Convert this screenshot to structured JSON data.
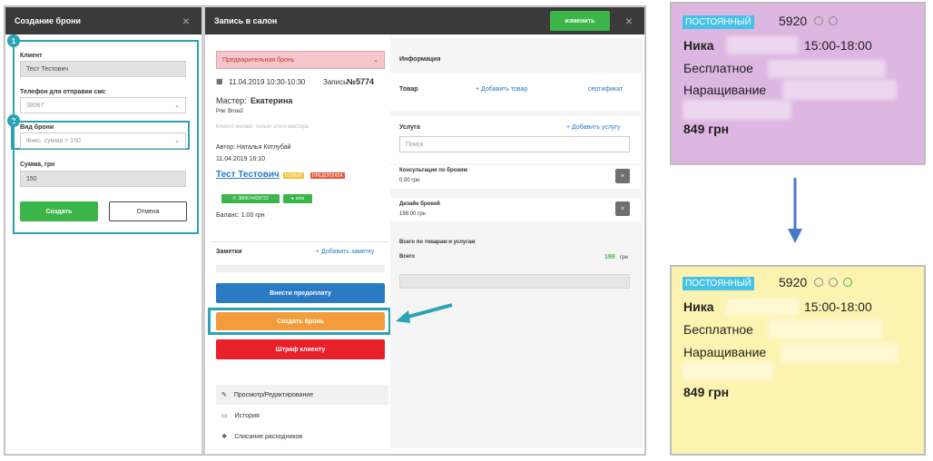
{
  "left_panel": {
    "title": "Создание брони",
    "close_icon": "×",
    "client_label": "Клиент",
    "client_value": "Тест Тестович",
    "phone_label": "Телефон для отправки смс",
    "phone_value": "38067",
    "type_label": "Вид брони",
    "type_value": "Фикс. сумма = 150",
    "sum_label": "Сумма, грн",
    "sum_value": "150",
    "create_label": "Создать",
    "cancel_label": "Отмена",
    "badge1": "1",
    "badge2": "2"
  },
  "right_panel": {
    "title": "Запись в салон",
    "edit_label": "изменить",
    "close_icon": "×",
    "status_value": "Предварительная бронь",
    "date_time": "11.04.2019 10:30-10:30",
    "record_prefix": "Запись ",
    "record_num": "№5774",
    "master_prefix": "Мастер: ",
    "master_name": "Екатерина",
    "room": "Р/м: Brow2",
    "client_wants": "Клиент желает только этого мастера",
    "author": "Автор: Наталья Котлубай",
    "author_date": "11.04.2019 16:10",
    "client_name": "Тест Тестович",
    "tag_new": "НОВЫЙ",
    "tag_prepay": "ПРЕДОПЛАТА",
    "phone_chip": "380674429722",
    "sms_chip": "sms",
    "balance": "Баланс: 1.00 грн",
    "notes_label": "Заметки",
    "add_note": "+ Добавить заметку",
    "prepay_btn": "Внести предоплату",
    "create_booking_btn": "Создать бронь",
    "fine_btn": "Штраф клиенту",
    "menu_view": "Просмотр/Редактирование",
    "menu_history": "История",
    "menu_consumables": "Списание расходников",
    "info_label": "Информация",
    "goods_label": "Товар",
    "add_goods": "+ Добавить товар",
    "certificate": "сертификат",
    "service_label": "Услуга",
    "add_service": "+ Добавить услугу",
    "search_placeholder": "Поиск",
    "service1_name": "Консультация по бровям",
    "service1_price": "0.00 грн",
    "service2_name": "Дизайн бровей",
    "service2_price": "199.00 грн",
    "x_label": "×",
    "total_label": "Всего по товарам и услугам",
    "total_row_label": "Всего",
    "total_value": "199",
    "total_currency": "грн"
  },
  "card_top": {
    "status": "ПОСТОЯННЫЙ",
    "num": "5920",
    "name": "Ника",
    "time": "15:00-18:00",
    "line1": "Бесплатное",
    "line2": "Наращивание",
    "price": "849 грн"
  },
  "card_bottom": {
    "status": "ПОСТОЯННЫЙ",
    "num": "5920",
    "name": "Ника",
    "time": "15:00-18:00",
    "line1": "Бесплатное",
    "line2": "Наращивание",
    "price": "849 грн"
  },
  "colors": {
    "accent": "#29a3b5",
    "green": "#3cb54a",
    "blue_btn": "#2a7bc4",
    "orange_btn": "#f39c3b",
    "red_btn": "#e8202a",
    "card_top_bg": "#ddb6e2",
    "card_bottom_bg": "#fdf3b0",
    "arrow": "#4a79c8"
  }
}
